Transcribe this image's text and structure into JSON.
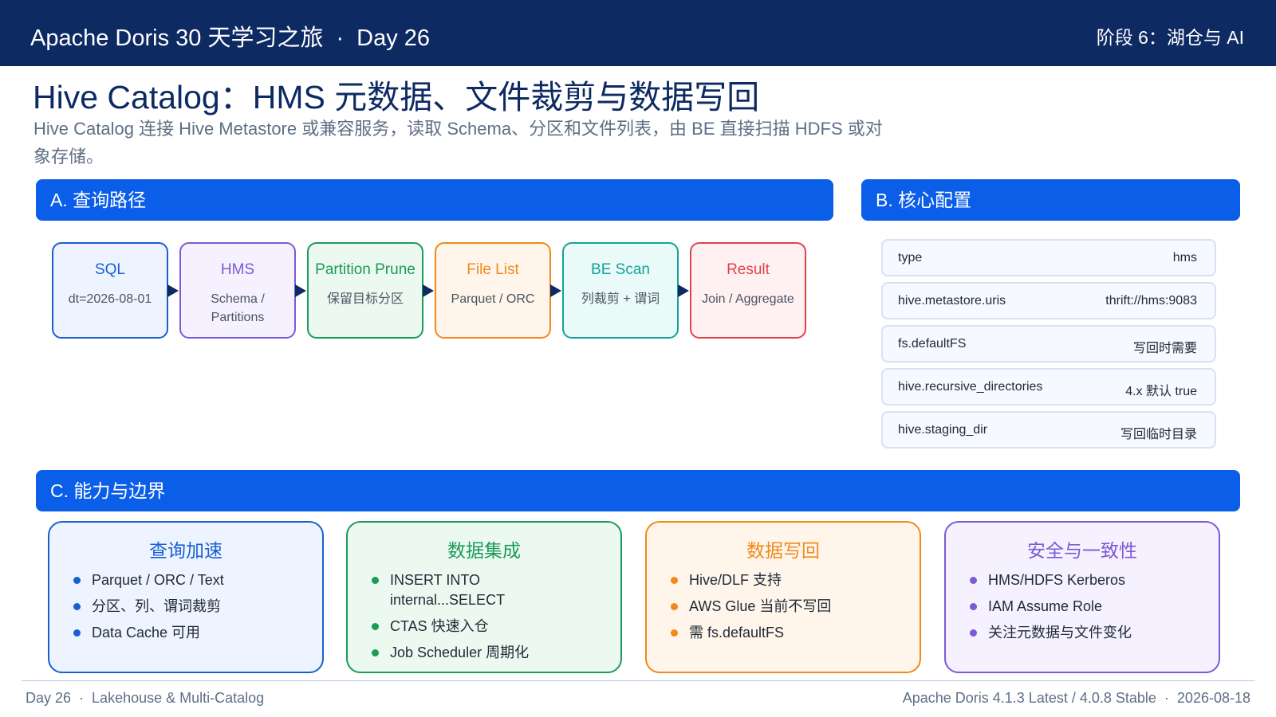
{
  "header": {
    "title": "Apache Doris 30 天学习之旅",
    "separator": "·",
    "day": "Day 26",
    "stage": "阶段 6：湖仓与 AI"
  },
  "page": {
    "title": "Hive Catalog：HMS 元数据、文件裁剪与数据写回",
    "subtitle": "Hive Catalog 连接 Hive Metastore 或兼容服务，读取 Schema、分区和文件列表，由 BE 直接扫描 HDFS 或对象存储。"
  },
  "section_a": {
    "label": "A. 查询路径",
    "steps": [
      {
        "title": "SQL",
        "sub": "dt=2026-08-01",
        "color": "#1a5fd0",
        "bg": "#eef4ff"
      },
      {
        "title": "HMS",
        "sub": "Schema / Partitions",
        "color": "#7c5ad6",
        "bg": "#f5f1ff"
      },
      {
        "title": "Partition Prune",
        "sub": "保留目标分区",
        "color": "#1c9a5a",
        "bg": "#ecf9f1"
      },
      {
        "title": "File List",
        "sub": "Parquet / ORC",
        "color": "#f08a1c",
        "bg": "#fff5ea"
      },
      {
        "title": "BE Scan",
        "sub": "列裁剪 + 谓词",
        "color": "#13a39a",
        "bg": "#eafaf8"
      },
      {
        "title": "Result",
        "sub": "Join / Aggregate",
        "color": "#e0434b",
        "bg": "#fff1f1"
      }
    ]
  },
  "section_b": {
    "label": "B. 核心配置",
    "rows": [
      {
        "key": "type",
        "value": "hms"
      },
      {
        "key": "hive.metastore.uris",
        "value": "thrift://hms:9083"
      },
      {
        "key": "fs.defaultFS",
        "value": "写回时需要"
      },
      {
        "key": "hive.recursive_directories",
        "value": "4.x 默认 true"
      },
      {
        "key": "hive.staging_dir",
        "value": "写回临时目录"
      }
    ]
  },
  "section_c": {
    "label": "C. 能力与边界",
    "cards": [
      {
        "title": "查询加速",
        "color": "#1a5fd0",
        "bg": "#eef4ff",
        "items": [
          "Parquet / ORC / Text",
          "分区、列、谓词裁剪",
          "Data Cache 可用"
        ]
      },
      {
        "title": "数据集成",
        "color": "#1c9a5a",
        "bg": "#ecf9f1",
        "items": [
          "INSERT INTO internal...SELECT",
          "CTAS 快速入仓",
          "Job Scheduler 周期化"
        ]
      },
      {
        "title": "数据写回",
        "color": "#f08a1c",
        "bg": "#fff5ea",
        "items": [
          "Hive/DLF 支持",
          "AWS Glue 当前不写回",
          "需 fs.defaultFS"
        ]
      },
      {
        "title": "安全与一致性",
        "color": "#7c5ad6",
        "bg": "#f5f1ff",
        "items": [
          "HMS/HDFS Kerberos",
          "IAM Assume Role",
          "关注元数据与文件变化"
        ]
      }
    ]
  },
  "footer": {
    "day": "Day 26",
    "topic": "Lakehouse & Multi-Catalog",
    "separator": "·",
    "version": "Apache Doris 4.1.3 Latest / 4.0.8 Stable",
    "date": "2026-08-18"
  }
}
